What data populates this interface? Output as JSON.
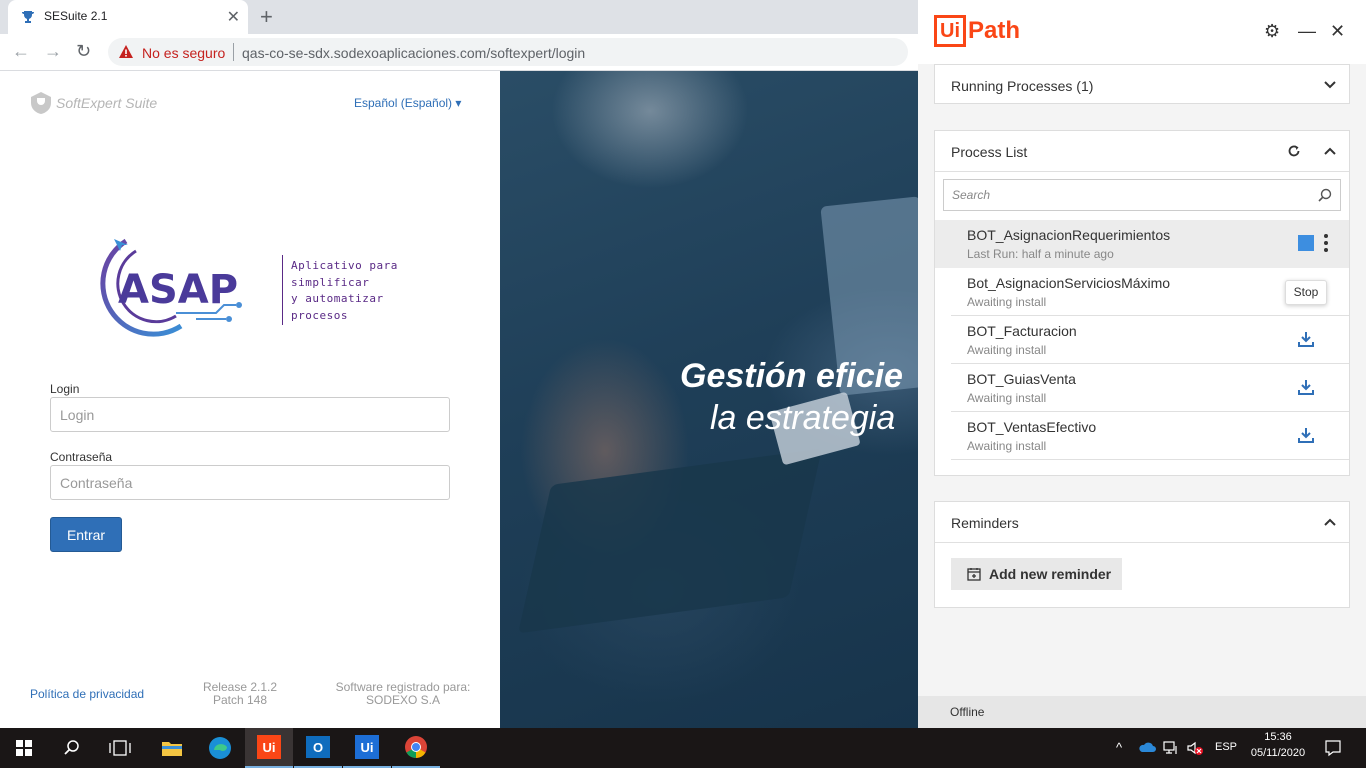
{
  "browser": {
    "tab_title": "SESuite 2.1",
    "insecure_label": "No es seguro",
    "url": "qas-co-se-sdx.sodexoaplicaciones.com/softexpert/login"
  },
  "login": {
    "brand": "SoftExpert Suite",
    "language": "Español (Español)",
    "asap_tagline": [
      "Aplicativo para",
      "simplificar",
      "y automatizar",
      "procesos"
    ],
    "login_label": "Login",
    "login_placeholder": "Login",
    "password_label": "Contraseña",
    "password_placeholder": "Contraseña",
    "submit_label": "Entrar",
    "privacy_link": "Política de privacidad",
    "release": "Release 2.1.2",
    "patch": "Patch 148",
    "registered_label": "Software registrado para:",
    "registered_to": "SODEXO S.A"
  },
  "hero": {
    "line1": "Gestión eficie",
    "line2": "la estrategia"
  },
  "uipath": {
    "logo_ui": "Ui",
    "logo_path": "Path",
    "running_title": "Running Processes (1)",
    "process_list_title": "Process List",
    "search_placeholder": "Search",
    "processes": [
      {
        "name": "BOT_AsignacionRequerimientos",
        "status": "Last Run: half a minute ago"
      },
      {
        "name": "Bot_AsignacionServiciosMáximo",
        "status": "Awaiting install"
      },
      {
        "name": "BOT_Facturacion",
        "status": "Awaiting install"
      },
      {
        "name": "BOT_GuiasVenta",
        "status": "Awaiting install"
      },
      {
        "name": "BOT_VentasEfectivo",
        "status": "Awaiting install"
      }
    ],
    "tooltip": "Stop",
    "reminders_title": "Reminders",
    "add_reminder": "Add new reminder",
    "status": "Offline"
  },
  "taskbar": {
    "lang": "ESP",
    "time": "15:36",
    "date": "05/11/2020"
  },
  "colors": {
    "uipath_orange": "#fa4616",
    "login_blue": "#2f6fb7",
    "stop_blue": "#3d8ee0"
  }
}
